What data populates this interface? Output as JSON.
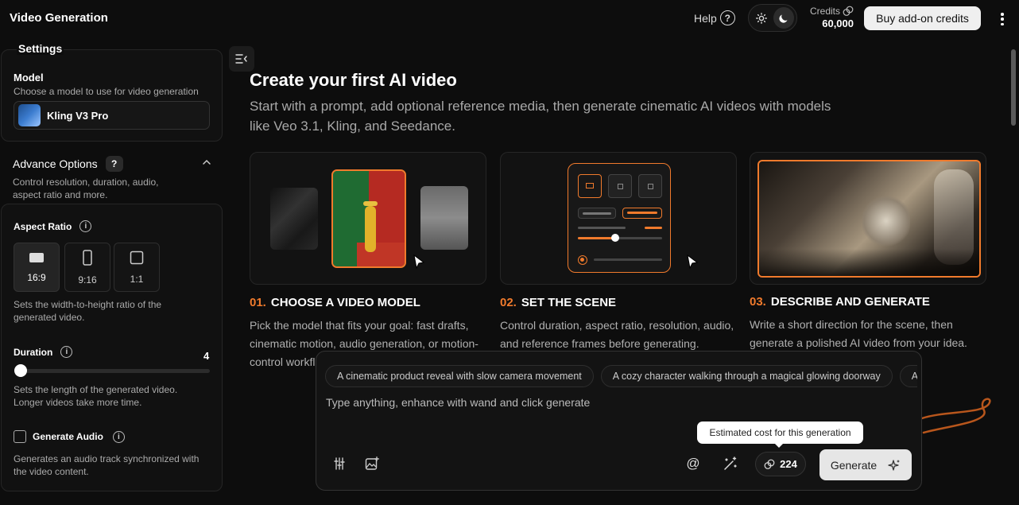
{
  "header": {
    "title": "Video Generation",
    "help_label": "Help",
    "credits_label": "Credits",
    "credits_value": "60,000",
    "buy_label": "Buy add-on credits"
  },
  "sidebar": {
    "settings_title": "Settings",
    "model": {
      "label": "Model",
      "description": "Choose a model to use for video generation",
      "selected": "Kling V3 Pro"
    },
    "advanced": {
      "title": "Advance Options",
      "badge": "?",
      "description": "Control resolution, duration, audio, aspect ratio and more."
    },
    "aspect_ratio": {
      "label": "Aspect Ratio",
      "options": [
        "16:9",
        "9:16",
        "1:1"
      ],
      "selected": "16:9",
      "description": "Sets the width-to-height ratio of the generated video."
    },
    "duration": {
      "label": "Duration",
      "value": "4",
      "description": "Sets the length of the generated video. Longer videos take more time."
    },
    "audio": {
      "label": "Generate Audio",
      "checked": false,
      "description": "Generates an audio track synchronized with the video content."
    }
  },
  "main": {
    "title": "Create your first AI video",
    "description": "Start with a prompt, add optional reference media, then generate cinematic AI videos with models like Veo 3.1, Kling, and Seedance.",
    "steps": [
      {
        "num": "01.",
        "title": "CHOOSE A VIDEO MODEL",
        "description": "Pick the model that fits your goal: fast drafts, cinematic motion, audio generation, or motion-control workflows."
      },
      {
        "num": "02.",
        "title": "SET THE SCENE",
        "description": "Control duration, aspect ratio, resolution, audio, and reference frames before generating."
      },
      {
        "num": "03.",
        "title": "DESCRIBE AND GENERATE",
        "description": "Write a short direction for the scene, then generate a polished AI video from your idea."
      }
    ]
  },
  "prompt": {
    "chips": [
      "A cinematic product reveal with slow camera movement",
      "A cozy character walking through a magical glowing doorway",
      "An"
    ],
    "placeholder": "Type anything, enhance with wand and click generate",
    "cost": "224",
    "tooltip": "Estimated cost for this generation",
    "generate_label": "Generate"
  },
  "colors": {
    "accent": "#f07a2c",
    "background": "#0d0d0d",
    "panel": "#111111"
  }
}
